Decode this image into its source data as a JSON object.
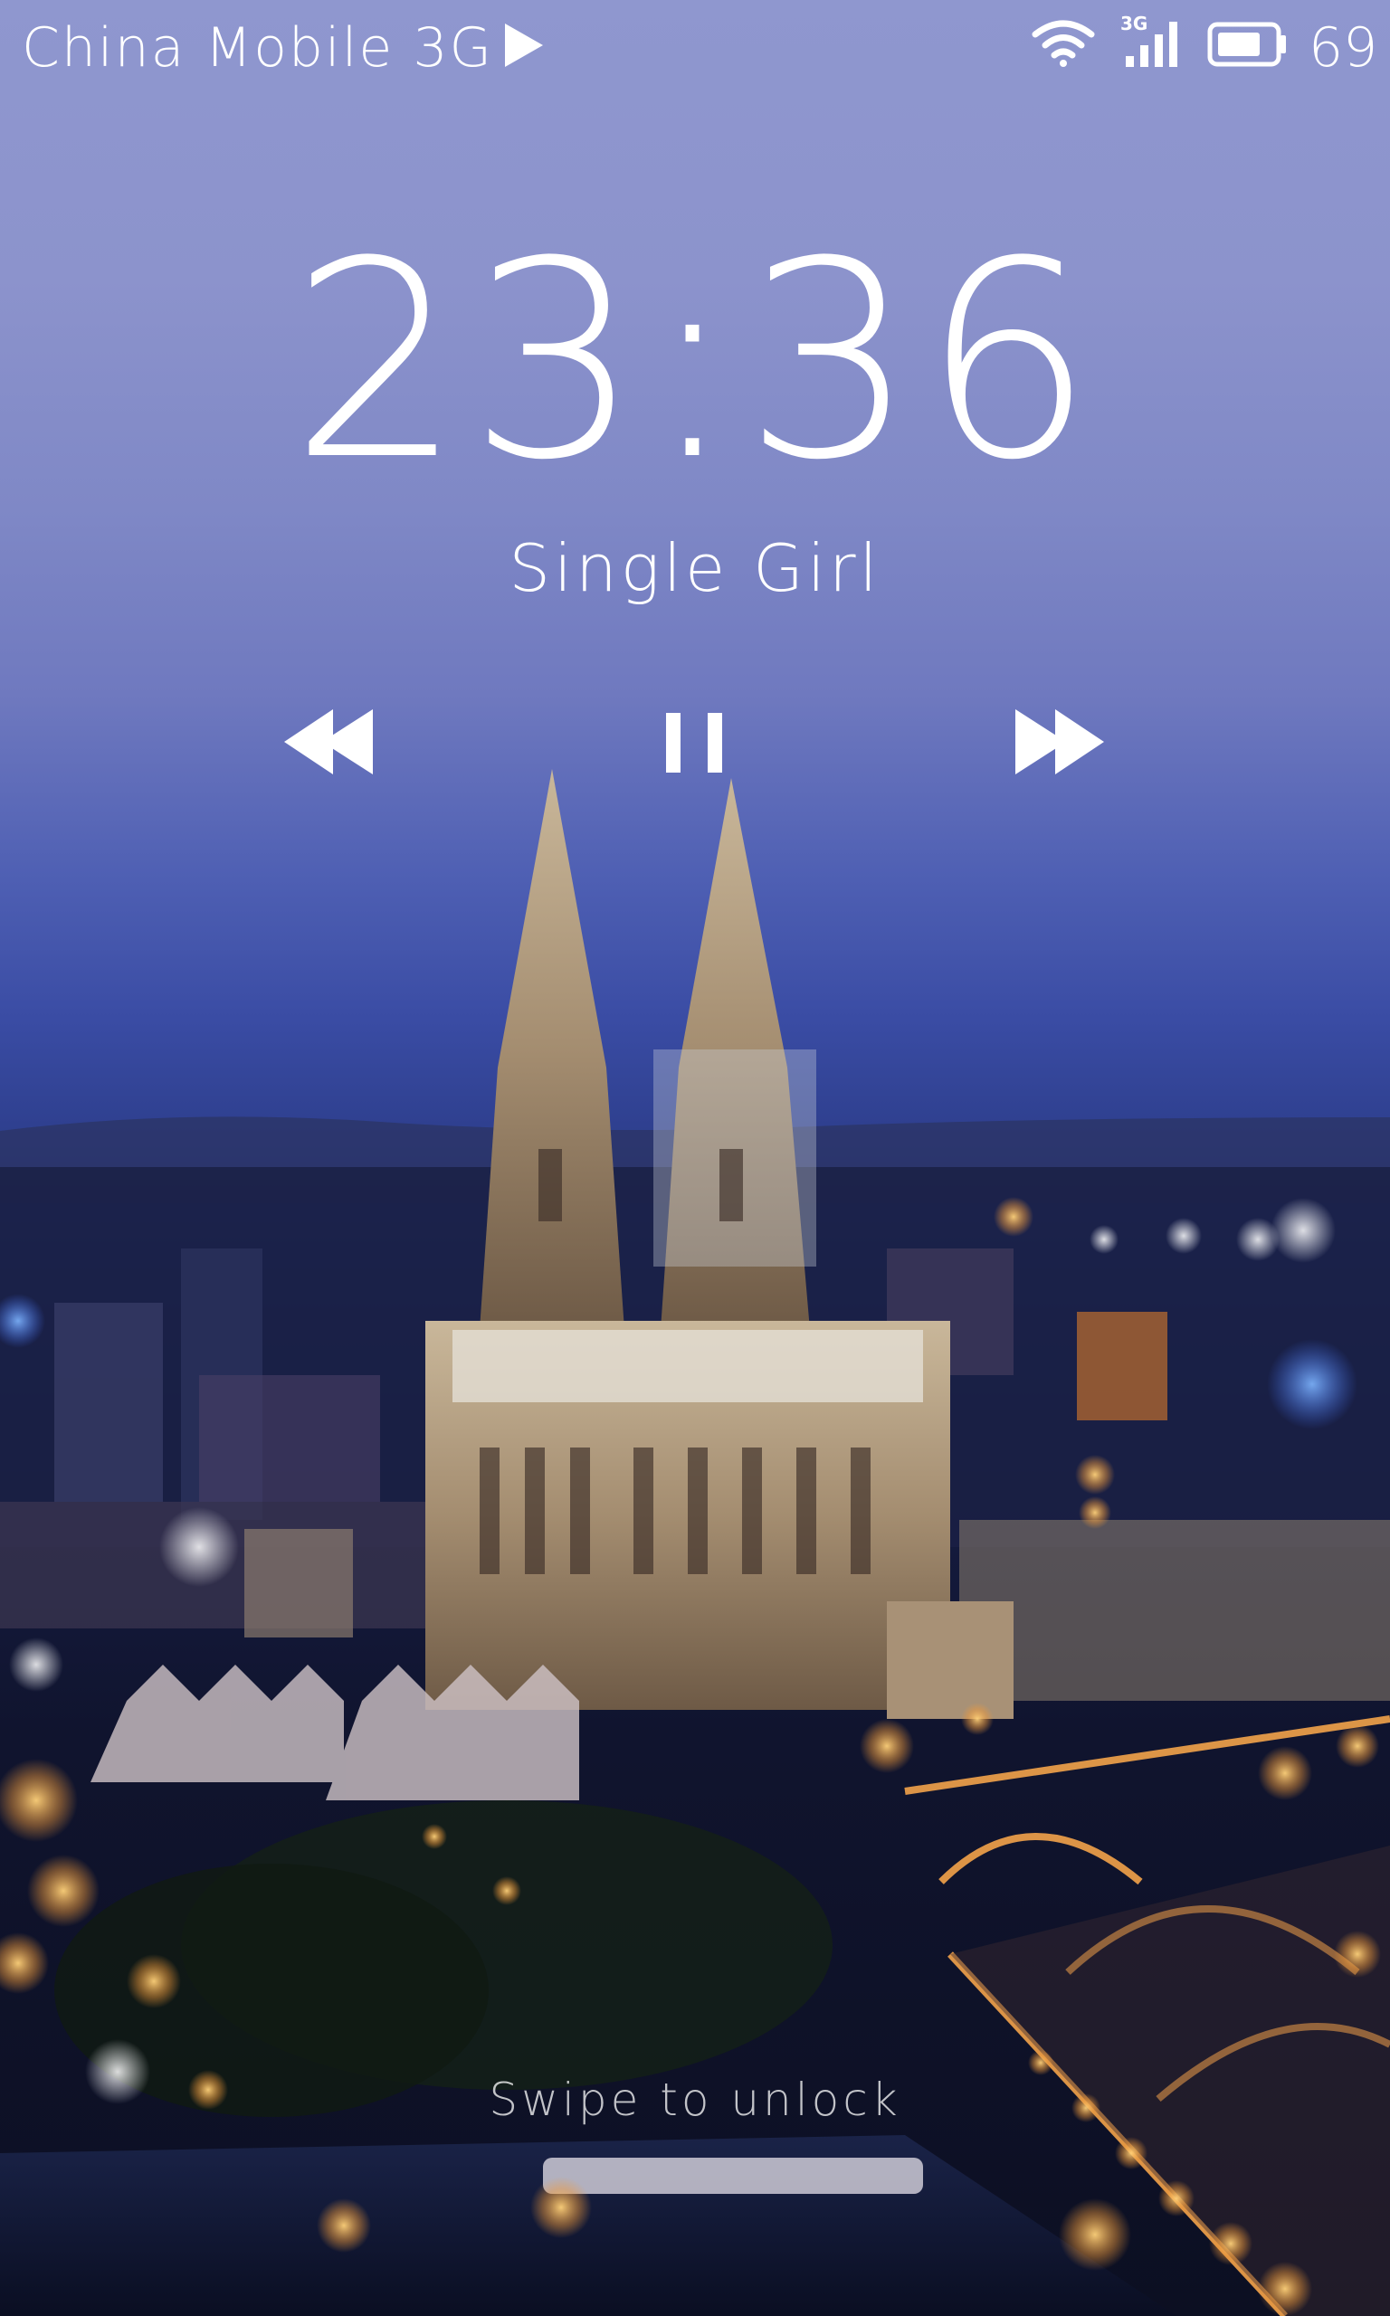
{
  "status_bar": {
    "carrier": "China Mobile 3G",
    "network_type": "3G",
    "battery_level": "69",
    "icons": [
      "play-indicator-icon",
      "wifi-icon",
      "signal-icon",
      "battery-icon"
    ]
  },
  "clock": {
    "hours": "23",
    "separator": ":",
    "minutes": "36"
  },
  "media": {
    "song_title": "Single Girl",
    "controls": [
      "rewind-icon",
      "pause-icon",
      "fast-forward-icon"
    ]
  },
  "lock": {
    "hint": "Swipe to unlock"
  },
  "colors": {
    "text": "#ffffff",
    "sky_top": "#8f97cf",
    "sky_mid": "#3a4ca4",
    "city_lights": "#f0a040"
  }
}
